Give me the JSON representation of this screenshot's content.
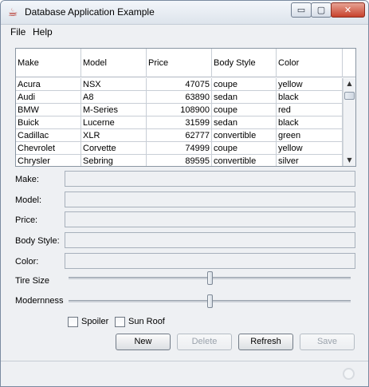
{
  "window": {
    "title": "Database Application Example",
    "controls": {
      "minimize": "▭",
      "maximize": "▢",
      "close": "✕"
    }
  },
  "menu": [
    {
      "label": "File"
    },
    {
      "label": "Help"
    }
  ],
  "table": {
    "columns": [
      "Make",
      "Model",
      "Price",
      "Body Style",
      "Color"
    ],
    "rows": [
      [
        "Acura",
        "NSX",
        "47075",
        "coupe",
        "yellow"
      ],
      [
        "Audi",
        "A8",
        "63890",
        "sedan",
        "black"
      ],
      [
        "BMW",
        "M-Series",
        "108900",
        "coupe",
        "red"
      ],
      [
        "Buick",
        "Lucerne",
        "31599",
        "sedan",
        "black"
      ],
      [
        "Cadillac",
        "XLR",
        "62777",
        "convertible",
        "green"
      ],
      [
        "Chevrolet",
        "Corvette",
        "74999",
        "coupe",
        "yellow"
      ],
      [
        "Chrysler",
        "Sebring",
        "89595",
        "convertible",
        "silver"
      ]
    ],
    "scrollbar": {
      "up": "▲",
      "down": "▼"
    }
  },
  "form": {
    "make_label": "Make:",
    "model_label": "Model:",
    "price_label": "Price:",
    "body_style_label": "Body Style:",
    "color_label": "Color:",
    "make_value": "",
    "model_value": "",
    "price_value": "",
    "body_style_value": "",
    "color_value": ""
  },
  "sliders": {
    "tire_size_label": "Tire Size",
    "modernness_label": "Modernness",
    "tire_size_fraction": 0.5,
    "modernness_fraction": 0.5
  },
  "checkboxes": {
    "spoiler_label": "Spoiler",
    "sun_roof_label": "Sun Roof",
    "spoiler_checked": false,
    "sun_roof_checked": false
  },
  "buttons": {
    "new": "New",
    "delete": "Delete",
    "refresh": "Refresh",
    "save": "Save"
  }
}
